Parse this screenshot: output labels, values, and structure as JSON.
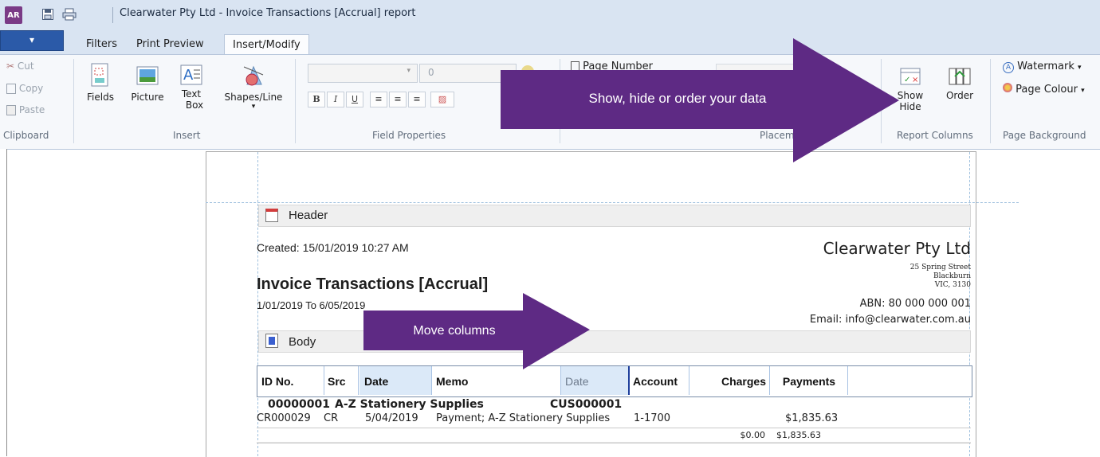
{
  "window": {
    "app_icon": "AR",
    "title": "Clearwater Pty Ltd - Invoice Transactions [Accrual] report",
    "quick_access": [
      "save-icon",
      "print-icon"
    ]
  },
  "ribbon_tabs": {
    "file_glyph": "▾",
    "filters": "Filters",
    "print_preview": "Print Preview",
    "insert_modify": "Insert/Modify"
  },
  "clipboard": {
    "cut": "Cut",
    "copy": "Copy",
    "paste": "Paste",
    "label": "Clipboard"
  },
  "insert": {
    "fields": "Fields",
    "picture": "Picture",
    "text_line1": "Text",
    "text_line2": "Box",
    "shapes": "Shapes/Line",
    "shapes_caret": "▾",
    "label": "Insert"
  },
  "field_properties": {
    "font_size": "0",
    "bold": "B",
    "italic": "I",
    "underline": "U",
    "label": "Field Properties"
  },
  "page_number": {
    "label": "Page Number"
  },
  "placement": {
    "label": "Placem"
  },
  "report_columns": {
    "show_line1": "Show",
    "show_line2": "Hide",
    "order": "Order",
    "label": "Report Columns"
  },
  "page_background": {
    "watermark": "Watermark",
    "page_colour": "Page Colour",
    "label": "Page Background"
  },
  "callouts": {
    "show_hide": "Show, hide or order your data",
    "move_columns": "Move columns"
  },
  "report": {
    "header_section": "Header",
    "body_section": "Body",
    "created": "Created: 15/01/2019 10:27 AM",
    "title": "Invoice Transactions [Accrual]",
    "date_range": "1/01/2019 To 6/05/2019",
    "company": "Clearwater Pty Ltd",
    "address1": "25 Spring Street",
    "address2": "Blackburn",
    "address3": "VIC, 3130",
    "abn": "ABN: 80 000 000 001",
    "email": "Email: info@clearwater.com.au",
    "columns": [
      "ID No.",
      "Src",
      "Date",
      "Memo",
      "Date",
      "Account",
      "Charges",
      "Payments"
    ],
    "group": {
      "id": "00000001",
      "name": "A-Z Stationery Supplies",
      "code": "CUS000001"
    },
    "row": {
      "id": "CR000029",
      "src": "CR",
      "date": "5/04/2019",
      "memo": "Payment; A-Z Stationery Supplies",
      "account": "1-1700",
      "payments": "$1,835.63"
    },
    "totals": {
      "charges": "$0.00",
      "payments": "$1,835.63"
    }
  },
  "colors": {
    "callout_purple": "#5e2a84",
    "file_tab": "#2b5aa8",
    "selected_column": "#dbe9f8"
  }
}
